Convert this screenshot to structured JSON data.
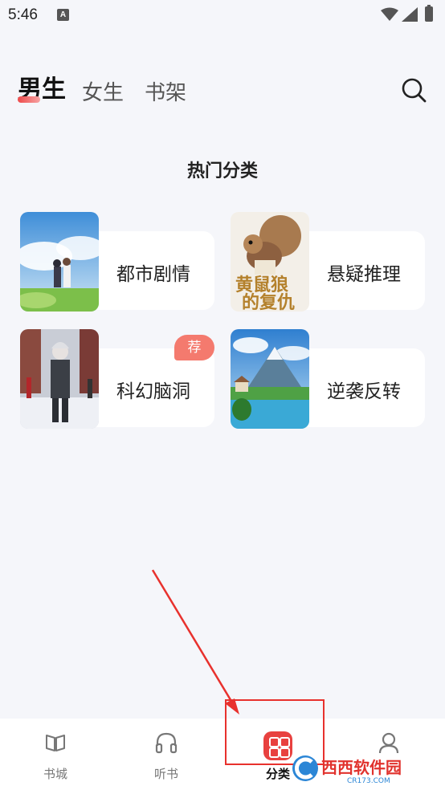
{
  "status_bar": {
    "time": "5:46",
    "notification_letter": "A"
  },
  "top_tabs": [
    {
      "label": "男生",
      "active": true
    },
    {
      "label": "女生",
      "active": false
    },
    {
      "label": "书架",
      "active": false
    }
  ],
  "section_title": "热门分类",
  "categories": [
    {
      "label": "都市剧情"
    },
    {
      "label": "悬疑推理",
      "cover_text": "黄鼠狼的复仇"
    },
    {
      "label": "科幻脑洞",
      "badge": "荐"
    },
    {
      "label": "逆袭反转"
    }
  ],
  "bottom_nav": [
    {
      "label": "书城",
      "icon": "book-icon"
    },
    {
      "label": "听书",
      "icon": "headphones-icon"
    },
    {
      "label": "分类",
      "icon": "category-grid-icon",
      "active": true
    },
    {
      "label": "",
      "icon": "user-icon"
    }
  ],
  "watermark": {
    "brand": "西西软件园",
    "site": "CR173.COM"
  },
  "colors": {
    "accent": "#e8413f",
    "badge": "#f47a6e",
    "background": "#f5f6fa"
  }
}
